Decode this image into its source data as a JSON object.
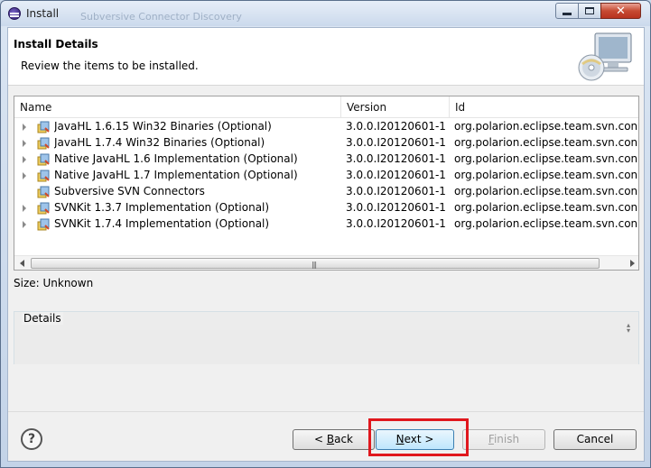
{
  "window": {
    "title": "Install",
    "ghost_title": "Subversive Connector Discovery"
  },
  "header": {
    "title": "Install Details",
    "description": "Review the items to be installed."
  },
  "table": {
    "columns": [
      "Name",
      "Version",
      "Id"
    ],
    "rows": [
      {
        "name": "JavaHL 1.6.15 Win32 Binaries (Optional)",
        "version": "3.0.0.I20120601-1...",
        "id": "org.polarion.eclipse.team.svn.connector",
        "expandable": true
      },
      {
        "name": "JavaHL 1.7.4 Win32 Binaries (Optional)",
        "version": "3.0.0.I20120601-1...",
        "id": "org.polarion.eclipse.team.svn.connector",
        "expandable": true
      },
      {
        "name": "Native JavaHL 1.6 Implementation (Optional)",
        "version": "3.0.0.I20120601-1...",
        "id": "org.polarion.eclipse.team.svn.connector",
        "expandable": true
      },
      {
        "name": "Native JavaHL 1.7 Implementation (Optional)",
        "version": "3.0.0.I20120601-1...",
        "id": "org.polarion.eclipse.team.svn.connector",
        "expandable": true
      },
      {
        "name": "Subversive SVN Connectors",
        "version": "3.0.0.I20120601-1...",
        "id": "org.polarion.eclipse.team.svn.connector",
        "expandable": false
      },
      {
        "name": "SVNKit 1.3.7 Implementation (Optional)",
        "version": "3.0.0.I20120601-1...",
        "id": "org.polarion.eclipse.team.svn.connector",
        "expandable": true
      },
      {
        "name": "SVNKit 1.7.4 Implementation (Optional)",
        "version": "3.0.0.I20120601-1...",
        "id": "org.polarion.eclipse.team.svn.connector",
        "expandable": true
      }
    ]
  },
  "size_label": "Size: Unknown",
  "details": {
    "label": "Details"
  },
  "buttons": {
    "back": {
      "prefix": "< ",
      "mnemonic": "B",
      "rest": "ack"
    },
    "next": {
      "mnemonic": "N",
      "rest": "ext >"
    },
    "finish": {
      "mnemonic": "F",
      "rest": "inish"
    },
    "cancel": "Cancel",
    "help": "?"
  },
  "icons": {
    "app": "eclipse-icon",
    "wizard": "install-cd-monitor-icon",
    "package": "plugin-package-icon"
  },
  "colors": {
    "highlight": "#e0171d"
  }
}
